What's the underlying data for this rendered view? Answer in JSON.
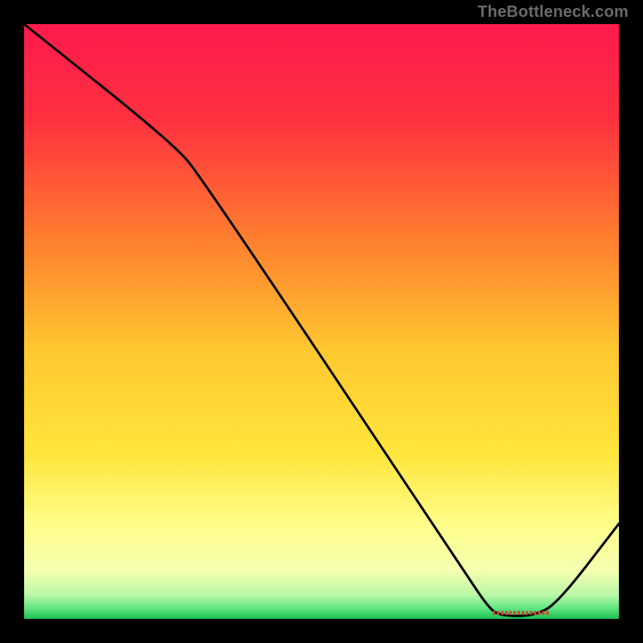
{
  "attribution": "TheBottleneck.com",
  "chart_data": {
    "type": "line",
    "title": "",
    "xlabel": "",
    "ylabel": "",
    "xlim": [
      0,
      100
    ],
    "ylim": [
      0,
      100
    ],
    "background_gradient_stops": [
      {
        "pct": 0,
        "color": "#ff1a4d"
      },
      {
        "pct": 16,
        "color": "#ff3040"
      },
      {
        "pct": 35,
        "color": "#ff7a2f"
      },
      {
        "pct": 55,
        "color": "#ffc82f"
      },
      {
        "pct": 72,
        "color": "#ffe53b"
      },
      {
        "pct": 85,
        "color": "#ffff8f"
      },
      {
        "pct": 92,
        "color": "#f4ffb0"
      },
      {
        "pct": 96,
        "color": "#b8f7a6"
      },
      {
        "pct": 98,
        "color": "#6be887"
      },
      {
        "pct": 100,
        "color": "#18c254"
      }
    ],
    "curve_points": [
      {
        "x": 0,
        "y": 100
      },
      {
        "x": 25,
        "y": 80
      },
      {
        "x": 30,
        "y": 74
      },
      {
        "x": 74,
        "y": 8
      },
      {
        "x": 78,
        "y": 2
      },
      {
        "x": 80,
        "y": 0.5
      },
      {
        "x": 86,
        "y": 0.5
      },
      {
        "x": 90,
        "y": 3
      },
      {
        "x": 100,
        "y": 16
      }
    ],
    "bottom_marker": {
      "label": "",
      "x_start": 79,
      "x_end": 88,
      "y": 1,
      "color": "#cc4a33"
    }
  }
}
